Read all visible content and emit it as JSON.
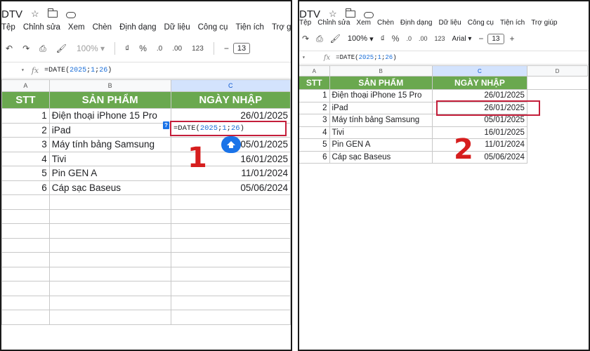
{
  "app": {
    "doc_title": "DTV",
    "menu": [
      "Tệp",
      "Chỉnh sửa",
      "Xem",
      "Chèn",
      "Định dạng",
      "Dữ liệu",
      "Công cụ",
      "Tiện ích",
      "Trợ giúp"
    ],
    "zoom": "100%",
    "font": "Arial",
    "font_size": "13",
    "toolbar": {
      "currency": "₫",
      "percent": "%",
      "dec_decrease": ".0",
      "dec_increase": ".00",
      "number_format": "123",
      "plus": "+"
    }
  },
  "formula": {
    "text_before": "=DATE(",
    "year": "2025",
    "sep1": ";",
    "month": "1",
    "sep2": ";",
    "day": "26",
    "text_after": ")"
  },
  "sheet": {
    "col_letters": [
      "A",
      "B",
      "C",
      "D"
    ],
    "headers": {
      "stt": "STT",
      "product": "SẢN PHẨM",
      "date": "NGÀY NHẬP"
    },
    "rows": [
      {
        "stt": "1",
        "product": "Điện thoại iPhone 15 Pro",
        "date": "26/01/2025"
      },
      {
        "stt": "2",
        "product": "iPad",
        "date": "26/01/2025"
      },
      {
        "stt": "3",
        "product": "Máy tính bảng Samsung",
        "date": "05/01/2025"
      },
      {
        "stt": "4",
        "product": "Tivi",
        "date": "16/01/2025"
      },
      {
        "stt": "5",
        "product": "Pin GEN A",
        "date": "11/01/2024"
      },
      {
        "stt": "6",
        "product": "Cáp sạc Baseus",
        "date": "05/06/2024"
      }
    ]
  },
  "annotations": {
    "step1": "1",
    "step2": "2"
  },
  "colors": {
    "header_green": "#6aa84f",
    "highlight_red": "#c41e3a",
    "step_red": "#d61e1e",
    "accent_blue": "#1a73e8"
  }
}
